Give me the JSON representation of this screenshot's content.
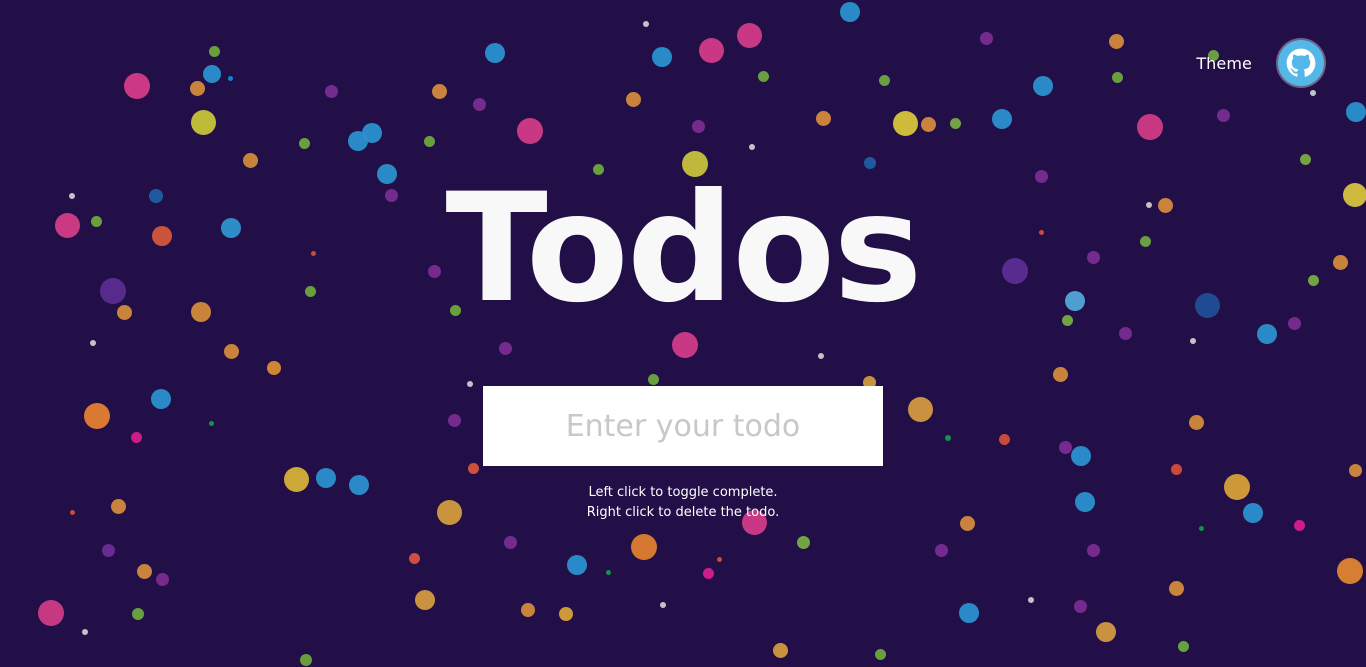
{
  "header": {
    "theme_label": "Theme"
  },
  "hero": {
    "title": "Todos",
    "input_placeholder": "Enter your todo",
    "help_line_1": "Left click to toggle complete.",
    "help_line_2": "Right click to delete the todo."
  },
  "icons": {
    "github": "github-icon"
  },
  "colors": {
    "background": "#220f48",
    "title": "#f8f8f8",
    "input": "#ffffff",
    "placeholder": "#c8c8c8",
    "github_badge": "#53b8e8"
  }
}
